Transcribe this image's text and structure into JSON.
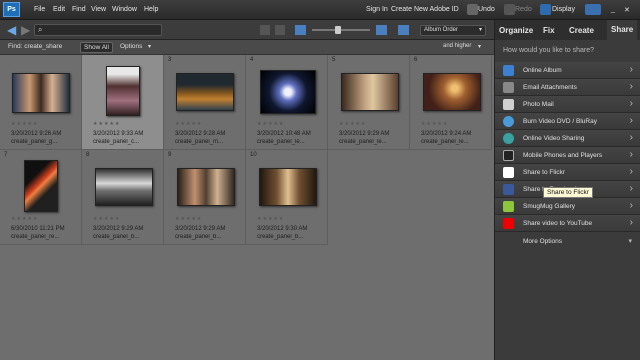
{
  "menu": {
    "file": "File",
    "edit": "Edit",
    "find": "Find",
    "view": "View",
    "window": "Window",
    "help": "Help"
  },
  "account": {
    "signin": "Sign In",
    "create": "Create New Adobe ID"
  },
  "tools": {
    "undo": "Undo",
    "redo": "Redo",
    "display": "Display"
  },
  "logo": "Ps",
  "toolbar": {
    "sort": "Album Order",
    "filter": "and higher"
  },
  "findbar": {
    "label": "Find: create_share",
    "show_all": "Show All",
    "options": "Options"
  },
  "photos": [
    {
      "num": "",
      "date": "3/20/2012 9:26 AM",
      "name": "create_panel_g..."
    },
    {
      "num": "",
      "date": "3/20/2012 9:33 AM",
      "name": "create_panel_c..."
    },
    {
      "num": "3",
      "date": "3/20/2012 9:28 AM",
      "name": "create_panel_m..."
    },
    {
      "num": "4",
      "date": "3/20/2012 10:48 AM",
      "name": "create_panel_le..."
    },
    {
      "num": "5",
      "date": "3/20/2012 9:29 AM",
      "name": "create_panel_le..."
    },
    {
      "num": "6",
      "date": "3/20/2012 9:24 AM",
      "name": "create_panel_le..."
    },
    {
      "num": "7",
      "date": "6/30/2010 11:21 PM",
      "name": "create_panel_re..."
    },
    {
      "num": "8",
      "date": "3/20/2012 9:29 AM",
      "name": "create_panel_b..."
    },
    {
      "num": "9",
      "date": "3/20/2012 9:29 AM",
      "name": "create_panel_b..."
    },
    {
      "num": "10",
      "date": "3/20/2012 9:30 AM",
      "name": "create_panel_b..."
    }
  ],
  "panel": {
    "tabs": [
      "Organize",
      "Fix",
      "Create",
      "Share"
    ],
    "prompt": "How would you like to share?",
    "items": [
      "Online Album",
      "Email Attachments",
      "Photo Mail",
      "Burn Video DVD / BluRay",
      "Online Video Sharing",
      "Mobile Phones and Players",
      "Share to Flickr",
      "Share to Facebook",
      "SmugMug Gallery",
      "Share video to YouTube"
    ],
    "more": "More Options",
    "tooltip": "Share to Flickr"
  }
}
